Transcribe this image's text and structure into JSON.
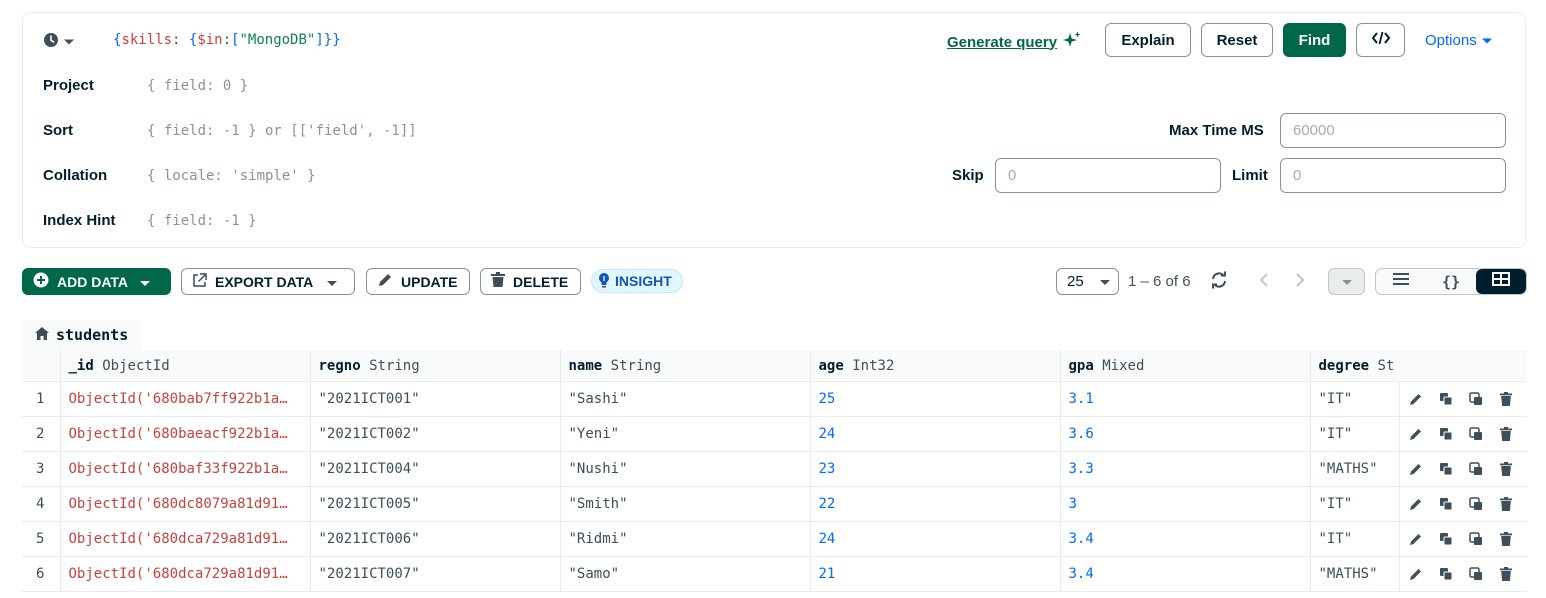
{
  "query": {
    "filter_tokens": [
      {
        "t": "{",
        "c": "tok-brace"
      },
      {
        "t": "skills",
        "c": "tok-key"
      },
      {
        "t": ": ",
        "c": "tok-colon"
      },
      {
        "t": "{",
        "c": "tok-brace"
      },
      {
        "t": "$in",
        "c": "tok-op"
      },
      {
        "t": ":",
        "c": "tok-colon"
      },
      {
        "t": "[",
        "c": "tok-bracket"
      },
      {
        "t": "\"MongoDB\"",
        "c": "tok-str"
      },
      {
        "t": "]",
        "c": "tok-bracket"
      },
      {
        "t": "}}",
        "c": "tok-brace"
      }
    ],
    "generate_query_label": "Generate query",
    "explain_label": "Explain",
    "reset_label": "Reset",
    "find_label": "Find",
    "options_label": "Options",
    "project_label": "Project",
    "project_placeholder": "{ field: 0 }",
    "sort_label": "Sort",
    "sort_placeholder": "{ field: -1 } or [['field', -1]]",
    "collation_label": "Collation",
    "collation_placeholder": "{ locale: 'simple' }",
    "index_hint_label": "Index Hint",
    "index_hint_placeholder": "{ field: -1 }",
    "max_time_label": "Max Time MS",
    "max_time_placeholder": "60000",
    "skip_label": "Skip",
    "skip_placeholder": "0",
    "limit_label": "Limit",
    "limit_placeholder": "0"
  },
  "toolbar": {
    "add_data_label": "ADD DATA",
    "export_data_label": "EXPORT DATA",
    "update_label": "UPDATE",
    "delete_label": "DELETE",
    "insight_label": "INSIGHT",
    "page_size": "25",
    "page_range": "1 – 6 of 6"
  },
  "collection": {
    "name": "students"
  },
  "table": {
    "columns": [
      {
        "name": "_id",
        "type": "ObjectId"
      },
      {
        "name": "regno",
        "type": "String"
      },
      {
        "name": "name",
        "type": "String"
      },
      {
        "name": "age",
        "type": "Int32"
      },
      {
        "name": "gpa",
        "type": "Mixed"
      },
      {
        "name": "degree",
        "type": "St"
      }
    ],
    "rows": [
      {
        "idx": "1",
        "id": "ObjectId('680bab7ff922b1a…",
        "regno": "\"2021ICT001\"",
        "name": "\"Sashi\"",
        "age": "25",
        "gpa": "3.1",
        "degree": "\"IT\""
      },
      {
        "idx": "2",
        "id": "ObjectId('680baeacf922b1a…",
        "regno": "\"2021ICT002\"",
        "name": "\"Yeni\"",
        "age": "24",
        "gpa": "3.6",
        "degree": "\"IT\""
      },
      {
        "idx": "3",
        "id": "ObjectId('680baf33f922b1a…",
        "regno": "\"2021ICT004\"",
        "name": "\"Nushi\"",
        "age": "23",
        "gpa": "3.3",
        "degree": "\"MATHS\""
      },
      {
        "idx": "4",
        "id": "ObjectId('680dc8079a81d91…",
        "regno": "\"2021ICT005\"",
        "name": "\"Smith\"",
        "age": "22",
        "gpa": "3",
        "degree": "\"IT\""
      },
      {
        "idx": "5",
        "id": "ObjectId('680dca729a81d91…",
        "regno": "\"2021ICT006\"",
        "name": "\"Ridmi\"",
        "age": "24",
        "gpa": "3.4",
        "degree": "\"IT\""
      },
      {
        "idx": "6",
        "id": "ObjectId('680dca729a81d91…",
        "regno": "\"2021ICT007\"",
        "name": "\"Samo\"",
        "age": "21",
        "gpa": "3.4",
        "degree": "\"MATHS\""
      }
    ]
  },
  "colors": {
    "accent_green": "#00684a",
    "link_blue": "#016bf8",
    "objectid_red": "#c8413e",
    "number_blue": "#016bf8"
  },
  "icons": [
    "clock-icon",
    "chevron-down-icon",
    "sparkle-icon",
    "code-icon",
    "plus-circle-icon",
    "export-icon",
    "pencil-icon",
    "trash-icon",
    "bulb-icon",
    "refresh-icon",
    "chevron-left-icon",
    "chevron-right-icon",
    "list-view-icon",
    "json-view-icon",
    "table-view-icon",
    "home-icon",
    "edit-icon",
    "copy-icon",
    "clone-icon",
    "delete-icon"
  ]
}
